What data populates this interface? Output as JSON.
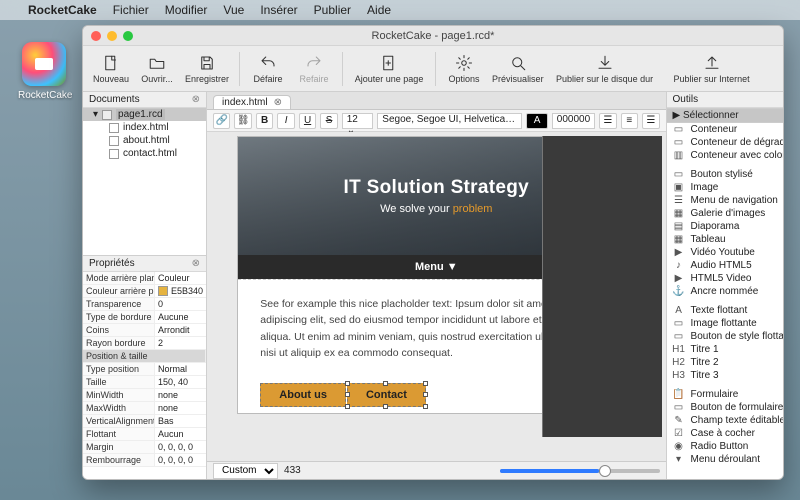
{
  "menubar": {
    "app": "RocketCake",
    "items": [
      "Fichier",
      "Modifier",
      "Vue",
      "Insérer",
      "Publier",
      "Aide"
    ]
  },
  "desktop": {
    "app_label": "RocketCake"
  },
  "window": {
    "title": "RocketCake - page1.rcd*",
    "toolbar": {
      "nouveau": "Nouveau",
      "ouvrir": "Ouvrir...",
      "enregistrer": "Enregistrer",
      "defaire": "Défaire",
      "refaire": "Refaire",
      "ajouter": "Ajouter une page",
      "options": "Options",
      "previsualiser": "Prévisualiser",
      "publier_local": "Publier sur le disque dur",
      "publier_net": "Publier sur Internet"
    }
  },
  "documents": {
    "title": "Documents",
    "root": "page1.rcd",
    "children": [
      "index.html",
      "about.html",
      "contact.html"
    ]
  },
  "properties": {
    "title": "Propriétés",
    "rows": [
      {
        "k": "Mode arrière plan",
        "v": "Couleur"
      },
      {
        "k": "Couleur arrière plan",
        "v": "E5B340",
        "swatch": true
      },
      {
        "k": "Transparence",
        "v": "0"
      },
      {
        "k": "Type de bordure",
        "v": "Aucune"
      },
      {
        "k": "Coins",
        "v": "Arrondit"
      },
      {
        "k": "Rayon bordure",
        "v": "2"
      }
    ],
    "section": "Position & taille",
    "rows2": [
      {
        "k": "Type position",
        "v": "Normal"
      },
      {
        "k": "Taille",
        "v": "150, 40"
      },
      {
        "k": "MinWidth",
        "v": "none"
      },
      {
        "k": "MaxWidth",
        "v": "none"
      },
      {
        "k": "VerticalAlignment",
        "v": "Bas"
      },
      {
        "k": "Flottant",
        "v": "Aucun"
      },
      {
        "k": "Margin",
        "v": "0, 0, 0, 0"
      },
      {
        "k": "Rembourrage",
        "v": "0, 0, 0, 0"
      }
    ]
  },
  "editor": {
    "tab": "index.html",
    "fontsize": "12",
    "fontfamily": "Segoe, Segoe UI, Helvetica Neue",
    "color_label": "A",
    "color_hex": "000000",
    "hero_title": "IT Solution Strategy",
    "hero_sub_pre": "We solve your ",
    "hero_sub_em": "problem",
    "menu_label": "Menu ▼",
    "body": "See for example this nice placholder text: Ipsum dolor sit amet, consectetur adipiscing elit, sed do eiusmod tempor incididunt ut labore et dolore magna aliqua. Ut enim ad minim veniam, quis nostrud exercitation ullamco laboris nisi ut aliquip ex ea commodo consequat.",
    "btn_about": "About us",
    "btn_contact": "Contact",
    "status_mode": "Custom",
    "status_width": "433"
  },
  "tools": {
    "title": "Outils",
    "select": "Sélectionner",
    "groups": [
      [
        "Conteneur",
        "Conteneur de dégradé",
        "Conteneur avec colonnes"
      ],
      [
        "Bouton stylisé",
        "Image",
        "Menu de navigation",
        "Galerie d'images",
        "Diaporama",
        "Tableau",
        "Vidéo Youtube",
        "Audio HTML5",
        "HTML5 Video",
        "Ancre nommée"
      ],
      [
        "Texte flottant",
        "Image flottante",
        "Bouton de style flottant",
        "Titre 1",
        "Titre 2",
        "Titre 3"
      ],
      [
        "Formulaire",
        "Bouton de formulaire",
        "Champ texte éditable",
        "Case à cocher",
        "Radio Button",
        "Menu déroulant"
      ]
    ],
    "icons": [
      [
        "▭",
        "▭",
        "▥"
      ],
      [
        "▭",
        "▣",
        "☰",
        "▦",
        "▤",
        "▦",
        "▶",
        "♪",
        "▶",
        "⚓"
      ],
      [
        "A",
        "▭",
        "▭",
        "H1",
        "H2",
        "H3"
      ],
      [
        "📋",
        "▭",
        "✎",
        "☑",
        "◉",
        "▾"
      ]
    ]
  }
}
